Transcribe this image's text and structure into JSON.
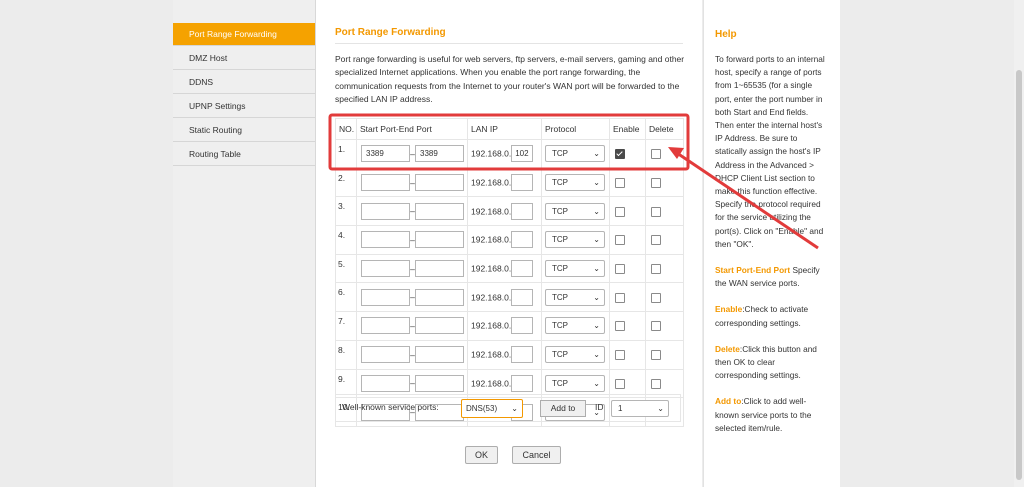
{
  "sidebar": {
    "items": [
      {
        "label": "Port Range Forwarding",
        "active": true
      },
      {
        "label": "DMZ Host",
        "active": false
      },
      {
        "label": "DDNS",
        "active": false
      },
      {
        "label": "UPNP Settings",
        "active": false
      },
      {
        "label": "Static Routing",
        "active": false
      },
      {
        "label": "Routing Table",
        "active": false
      }
    ]
  },
  "main": {
    "title": "Port Range Forwarding",
    "description": "Port range forwarding is useful for web servers, ftp servers, e-mail servers, gaming and other specialized Internet applications. When you enable the port range forwarding, the communication requests from the Internet to your router's WAN port will be forwarded to the specified LAN IP address.",
    "table": {
      "headers": {
        "no": "NO.",
        "ports": "Start Port-End Port",
        "lanip": "LAN IP",
        "protocol": "Protocol",
        "enable": "Enable",
        "delete": "Delete"
      },
      "rows": [
        {
          "no": "1.",
          "start": "3389",
          "end": "3389",
          "ip_prefix": "192.168.0.",
          "ip_last": "102",
          "protocol": "TCP",
          "enabled": true,
          "deleted": false
        },
        {
          "no": "2.",
          "start": "",
          "end": "",
          "ip_prefix": "192.168.0.",
          "ip_last": "",
          "protocol": "TCP",
          "enabled": false,
          "deleted": false
        },
        {
          "no": "3.",
          "start": "",
          "end": "",
          "ip_prefix": "192.168.0.",
          "ip_last": "",
          "protocol": "TCP",
          "enabled": false,
          "deleted": false
        },
        {
          "no": "4.",
          "start": "",
          "end": "",
          "ip_prefix": "192.168.0.",
          "ip_last": "",
          "protocol": "TCP",
          "enabled": false,
          "deleted": false
        },
        {
          "no": "5.",
          "start": "",
          "end": "",
          "ip_prefix": "192.168.0.",
          "ip_last": "",
          "protocol": "TCP",
          "enabled": false,
          "deleted": false
        },
        {
          "no": "6.",
          "start": "",
          "end": "",
          "ip_prefix": "192.168.0.",
          "ip_last": "",
          "protocol": "TCP",
          "enabled": false,
          "deleted": false
        },
        {
          "no": "7.",
          "start": "",
          "end": "",
          "ip_prefix": "192.168.0.",
          "ip_last": "",
          "protocol": "TCP",
          "enabled": false,
          "deleted": false
        },
        {
          "no": "8.",
          "start": "",
          "end": "",
          "ip_prefix": "192.168.0.",
          "ip_last": "",
          "protocol": "TCP",
          "enabled": false,
          "deleted": false
        },
        {
          "no": "9.",
          "start": "",
          "end": "",
          "ip_prefix": "192.168.0.",
          "ip_last": "",
          "protocol": "TCP",
          "enabled": false,
          "deleted": false
        },
        {
          "no": "10.",
          "start": "",
          "end": "",
          "ip_prefix": "192.168.0.",
          "ip_last": "",
          "protocol": "TCP",
          "enabled": false,
          "deleted": false
        }
      ]
    },
    "well_known": {
      "label": "Well-known service ports:",
      "service": "DNS(53)",
      "add_label": "Add to",
      "id_label": "ID",
      "id_value": "1"
    },
    "ok_label": "OK",
    "cancel_label": "Cancel"
  },
  "help": {
    "title": "Help",
    "intro": "To forward ports to an internal host, specify a range of ports from 1~65535 (for a single port, enter the port number in both Start and End fields. Then enter the internal host's IP Address. Be sure to statically assign the host's IP Address in the Advanced > DHCP Client List section to make this function effective. Specify the protocol required for the service utilizing the port(s). Click on \"Enable\" and then \"OK\".",
    "entries": [
      {
        "key": "Start Port-End Port",
        "text": " Specify the WAN service ports."
      },
      {
        "key": "Enable",
        "text": ":Check to activate corresponding settings."
      },
      {
        "key": "Delete",
        "text": ":Click this button and then OK to clear corresponding settings."
      },
      {
        "key": "Add to",
        "text": ":Click to add well-known service ports to the selected item/rule."
      }
    ]
  },
  "colors": {
    "accent": "#f39800",
    "active_tab": "#f5a200",
    "annotation": "#e23b3b"
  },
  "icons": {
    "dropdown": "chevron-down-icon",
    "annotation": "arrow-icon"
  }
}
